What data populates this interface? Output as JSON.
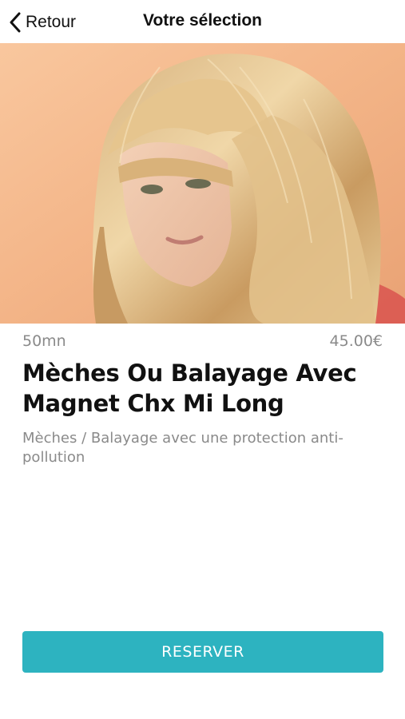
{
  "header": {
    "back_label": "Retour",
    "title": "Votre sélection",
    "back_icon": "chevron-left-icon"
  },
  "hero": {
    "image_subject": "woman with long blonde layered hair and bangs"
  },
  "service": {
    "duration": "50mn",
    "price": "45.00€",
    "name": "Mèches Ou Balayage Avec Magnet Chx Mi Long",
    "description": "Mèches / Balayage avec une protection anti-pollution"
  },
  "actions": {
    "reserve_label": "RESERVER"
  },
  "colors": {
    "accent": "#2db3c0",
    "text_primary": "#111111",
    "text_secondary": "#8a8a8a",
    "hero_background": "#f5b98a"
  }
}
